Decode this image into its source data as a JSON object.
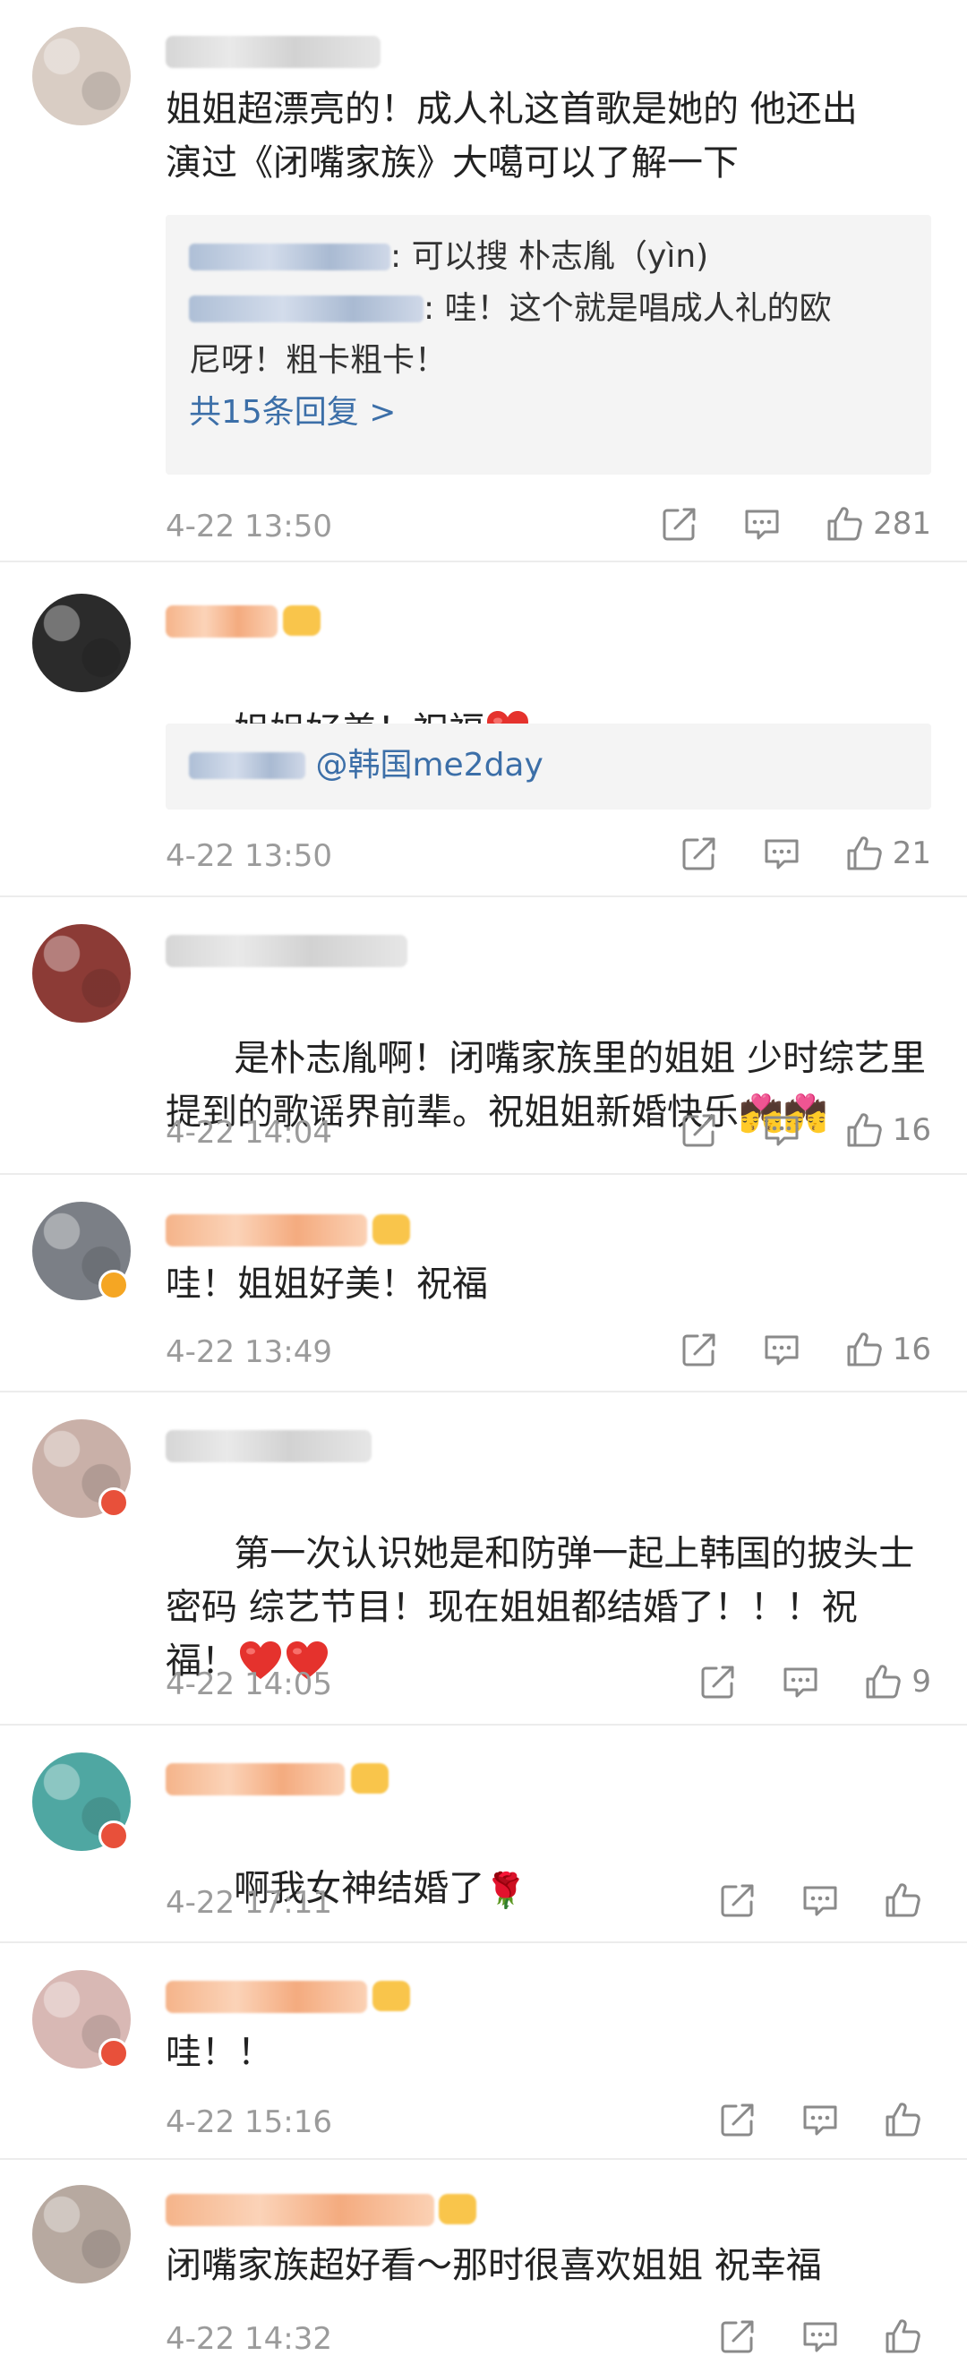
{
  "comments": [
    {
      "text": "姐姐超漂亮的！成人礼这首歌是她的 他还出\n演过《闭嘴家族》大噶可以了解一下",
      "replies": [
        {
          "text": ": 可以搜 朴志胤（yìn)"
        },
        {
          "text": ": 哇！这个就是唱成人礼的欧\n尼呀！粗卡粗卡！"
        }
      ],
      "more_replies": "共15条回复 >",
      "time": "4-22 13:50",
      "likes": "281"
    },
    {
      "text": "姐姐好美！祝福",
      "replies": [
        {
          "text": " @韩国me2day"
        }
      ],
      "time": "4-22 13:50",
      "likes": "21"
    },
    {
      "text": "是朴志胤啊！闭嘴家族里的姐姐 少时综艺里\n提到的歌谣界前辈。祝姐姐新婚快乐",
      "time": "4-22 14:04",
      "likes": "16"
    },
    {
      "text": "哇！姐姐好美！祝福",
      "time": "4-22 13:49",
      "likes": "16"
    },
    {
      "text": "第一次认识她是和防弹一起上韩国的披头士\n密码 综艺节目！现在姐姐都结婚了！！！祝\n福！",
      "time": "4-22 14:05",
      "likes": "9"
    },
    {
      "text": "啊我女神结婚了",
      "time": "4-22 17:11",
      "likes": ""
    },
    {
      "text": "哇！！",
      "time": "4-22 15:16",
      "likes": ""
    },
    {
      "text": "闭嘴家族超好看～那时很喜欢姐姐 祝幸福",
      "time": "4-22 14:32",
      "likes": ""
    }
  ],
  "colors": {
    "text": "#222222",
    "meta": "#9b9b9b",
    "reply_bg": "#f4f4f4",
    "link": "#3c6fa8",
    "heart": "#e5322d",
    "divider": "#ececec"
  },
  "icons": [
    "share-icon",
    "comment-icon",
    "like-icon",
    "heart-emoji",
    "kiss-couple-emoji",
    "rose-emoji"
  ]
}
